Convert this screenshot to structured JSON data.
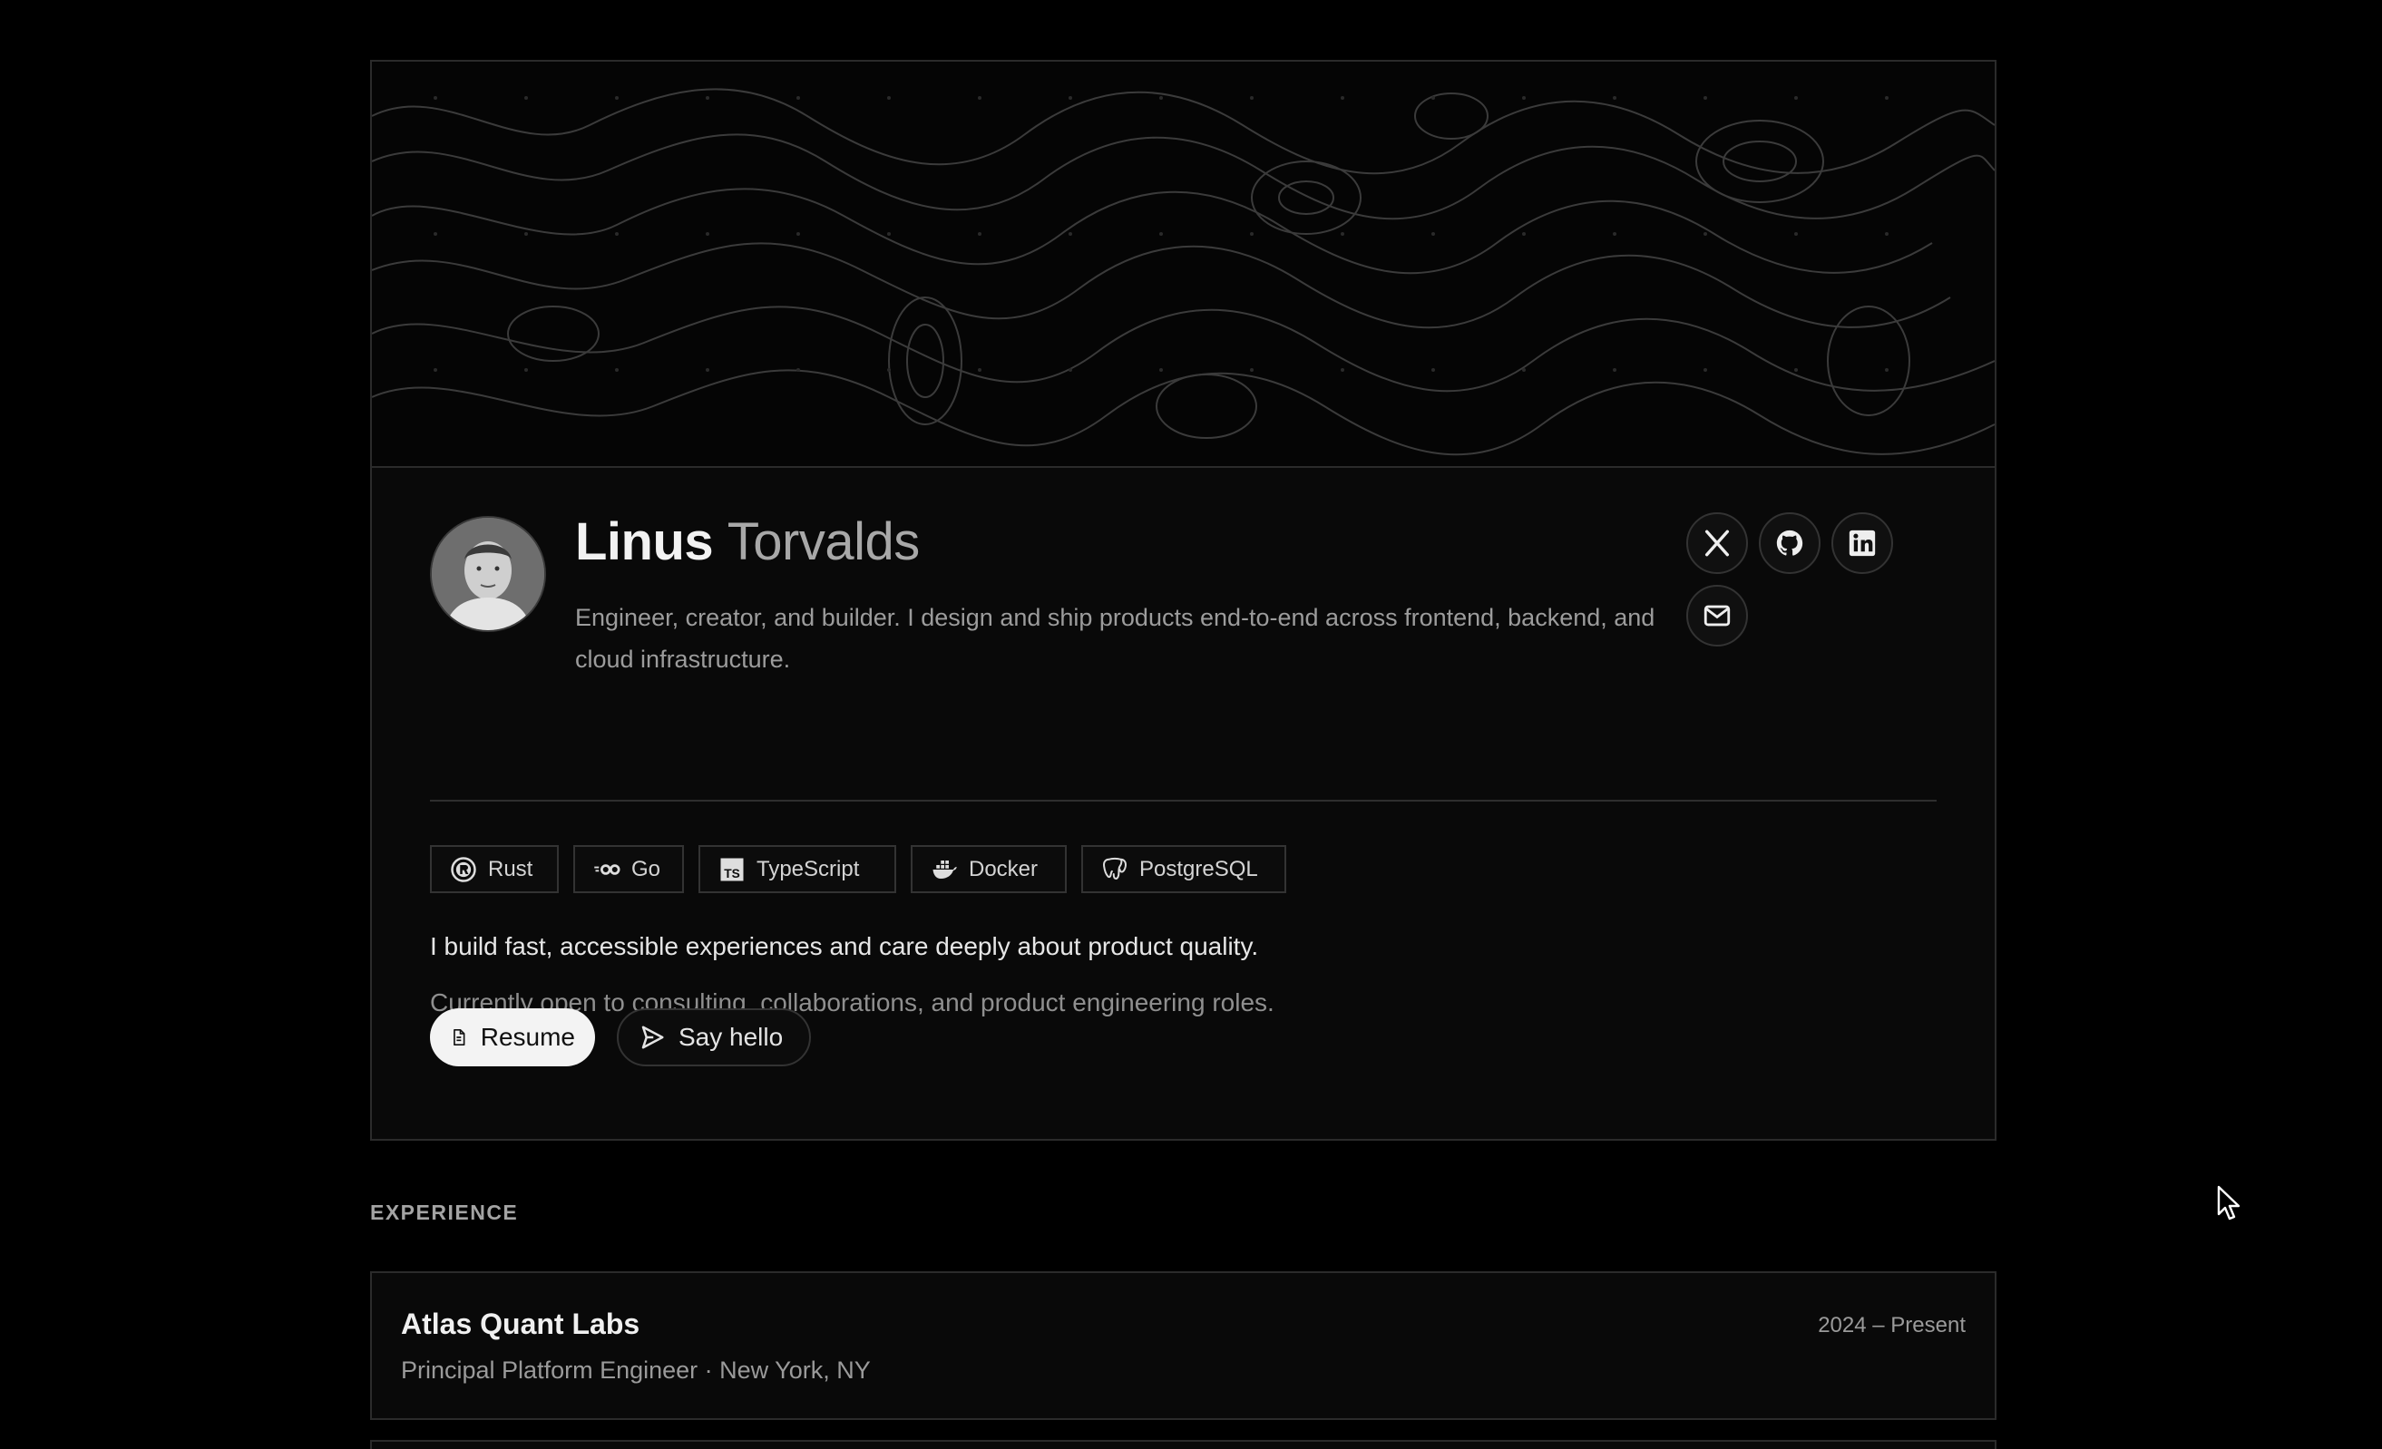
{
  "profile": {
    "first_name": "Linus",
    "last_name": "Torvalds",
    "bio": "Engineer, creator, and builder. I design and ship products end-to-end across frontend, backend, and cloud infrastructure.",
    "tagline": "I build fast, accessible experiences and care deeply about product quality.",
    "availability": "Currently open to consulting, collaborations, and product engineering roles."
  },
  "socials": [
    {
      "icon": "x-icon",
      "label": "X"
    },
    {
      "icon": "github-icon",
      "label": "GitHub"
    },
    {
      "icon": "linkedin-icon",
      "label": "LinkedIn"
    },
    {
      "icon": "mail-icon",
      "label": "Email"
    }
  ],
  "tags": [
    {
      "label": "Rust",
      "icon": "rust-icon"
    },
    {
      "label": "Go",
      "icon": "go-icon"
    },
    {
      "label": "TypeScript",
      "icon": "typescript-icon"
    },
    {
      "label": "Docker",
      "icon": "docker-icon"
    },
    {
      "label": "PostgreSQL",
      "icon": "postgresql-icon"
    }
  ],
  "buttons": {
    "resume": "Resume",
    "say_hello": "Say hello"
  },
  "experience": {
    "section_label": "EXPERIENCE",
    "items": [
      {
        "company": "Atlas Quant Labs",
        "role_location": "Principal Platform Engineer · New York, NY",
        "dates": "2024 – Present"
      }
    ]
  },
  "colors": {
    "background": "#000000",
    "card": "#090909",
    "border": "#2b2b2b",
    "primary_button": "#f3f3f3"
  }
}
